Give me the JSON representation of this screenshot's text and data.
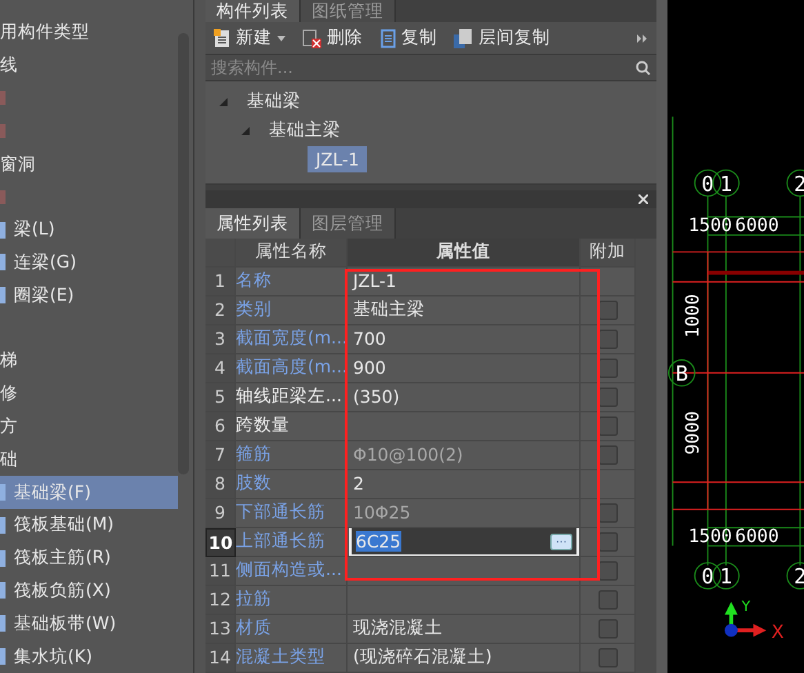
{
  "left_panel": {
    "items": [
      {
        "label": "用构件类型",
        "kind": "group"
      },
      {
        "label": "线",
        "kind": "group"
      },
      {
        "kind": "marker"
      },
      {
        "kind": "marker"
      },
      {
        "label": "窗洞",
        "kind": "group"
      },
      {
        "kind": "marker"
      },
      {
        "label": "梁(L)",
        "kind": "item",
        "selected": false
      },
      {
        "label": "连梁(G)",
        "kind": "item",
        "selected": false
      },
      {
        "label": "圈梁(E)",
        "kind": "item",
        "selected": false
      },
      {
        "kind": "blank"
      },
      {
        "label": "梯",
        "kind": "group"
      },
      {
        "label": "修",
        "kind": "group"
      },
      {
        "label": "方",
        "kind": "group"
      },
      {
        "label": "础",
        "kind": "group"
      },
      {
        "label": "基础梁(F)",
        "kind": "item",
        "selected": true
      },
      {
        "label": "筏板基础(M)",
        "kind": "item",
        "selected": false
      },
      {
        "label": "筏板主筋(R)",
        "kind": "item",
        "selected": false
      },
      {
        "label": "筏板负筋(X)",
        "kind": "item",
        "selected": false
      },
      {
        "label": "基础板带(W)",
        "kind": "item",
        "selected": false
      },
      {
        "label": "集水坑(K)",
        "kind": "item",
        "selected": false
      }
    ]
  },
  "component_panel": {
    "tabs": [
      {
        "label": "构件列表",
        "selected": true
      },
      {
        "label": "图纸管理",
        "selected": false
      }
    ],
    "toolbar": [
      {
        "label": "新建",
        "kind": "new"
      },
      {
        "label": "删除",
        "kind": "delete"
      },
      {
        "label": "复制",
        "kind": "copy"
      },
      {
        "label": "层间复制",
        "kind": "floor-copy"
      }
    ],
    "search": {
      "placeholder": "搜索构件..."
    },
    "tree": [
      {
        "label": "基础梁",
        "expanded": true,
        "selected": false,
        "children": [
          {
            "label": "基础主梁",
            "expanded": true,
            "selected": false,
            "children": [
              {
                "label": "JZL-1",
                "selected": true
              }
            ]
          }
        ]
      }
    ]
  },
  "property_panel": {
    "tabs": [
      {
        "label": "属性列表",
        "selected": true
      },
      {
        "label": "图层管理",
        "selected": false
      }
    ],
    "columns": [
      "属性名称",
      "属性值",
      "附加"
    ],
    "rows": [
      {
        "index": "1",
        "name": "名称",
        "public": true,
        "value": "JZL-1",
        "muted": false,
        "selected": false
      },
      {
        "index": "2",
        "name": "类别",
        "public": true,
        "value": "基础主梁",
        "muted": false,
        "checked": false,
        "selected": false
      },
      {
        "index": "3",
        "name": "截面宽度(m...",
        "public": true,
        "value": "700",
        "muted": false,
        "checked": false,
        "selected": false
      },
      {
        "index": "4",
        "name": "截面高度(m...",
        "public": true,
        "value": "900",
        "muted": false,
        "checked": false,
        "selected": false
      },
      {
        "index": "5",
        "name": "轴线距梁左...",
        "public": false,
        "value": "(350)",
        "muted": false,
        "checked": false,
        "selected": false
      },
      {
        "index": "6",
        "name": "跨数量",
        "public": false,
        "muted": false,
        "checked": false,
        "selected": false
      },
      {
        "index": "7",
        "name": "箍筋",
        "public": true,
        "value": "Φ10@100(2)",
        "muted": true,
        "checked": false,
        "selected": false
      },
      {
        "index": "8",
        "name": "肢数",
        "public": true,
        "value": "2",
        "muted": false,
        "selected": false
      },
      {
        "index": "9",
        "name": "下部通长筋",
        "public": true,
        "value": "10Φ25",
        "muted": true,
        "checked": false,
        "selected": false
      },
      {
        "index": "10",
        "name": "上部通长筋",
        "public": true,
        "value": "6C25",
        "muted": false,
        "checked": false,
        "selected": true,
        "edit_button": "···"
      },
      {
        "index": "11",
        "name": "侧面构造或...",
        "public": true,
        "muted": false,
        "checked": false,
        "selected": false
      },
      {
        "index": "12",
        "name": "拉筋",
        "public": true,
        "muted": false,
        "checked": false,
        "selected": false
      },
      {
        "index": "13",
        "name": "材质",
        "public": true,
        "value": "现浇混凝土",
        "muted": false,
        "checked": false,
        "selected": false
      },
      {
        "index": "14",
        "name": "混凝土类型",
        "public": true,
        "value": "(现浇碎石混凝土)",
        "muted": false,
        "checked": false,
        "selected": false
      }
    ]
  },
  "canvas": {
    "top_axes": [
      "0",
      "1",
      "2"
    ],
    "top_dims": [
      "1500",
      "6000"
    ],
    "row_axes": [
      "B"
    ],
    "vertical_dims": [
      "1000",
      "9000"
    ],
    "bottom_dims": [
      "1500",
      "6000"
    ],
    "bottom_axes": [
      "0",
      "1",
      "2"
    ],
    "ucs": {
      "x": "X",
      "y": "Y"
    }
  }
}
